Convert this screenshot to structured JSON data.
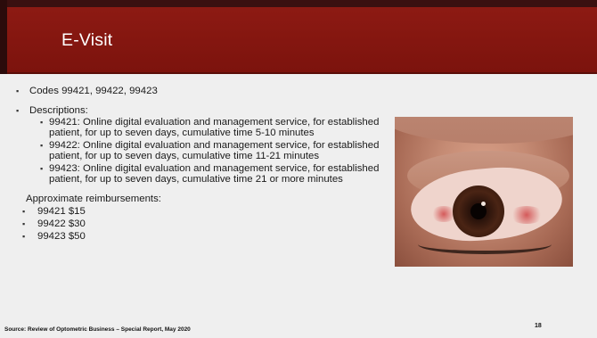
{
  "slide": {
    "title": "E-Visit",
    "codes_line": "Codes 99421, 99422, 99423",
    "descriptions_heading": "Descriptions:",
    "descriptions": [
      {
        "text": "99421: Online digital evaluation and management service, for established patient, for up to seven days, cumulative time 5-10 minutes"
      },
      {
        "text": "99422: Online digital evaluation and management service, for established patient, for up to seven days, cumulative time 11-21 minutes"
      },
      {
        "text": "99423: Online digital evaluation and management service, for established patient, for up to seven days, cumulative time 21 or more minutes"
      }
    ],
    "reimbursements_heading": "Approximate reimbursements:",
    "reimbursements": [
      {
        "text": "99421 $15"
      },
      {
        "text": "99422 $30"
      },
      {
        "text": "99423 $50"
      }
    ],
    "source": "Source: Review of Optometric Business – Special Report, May 2020",
    "page_number": "18"
  },
  "colors": {
    "header": "#8d1a13",
    "background": "#efefef"
  },
  "image": {
    "icon": "eye-photo"
  }
}
